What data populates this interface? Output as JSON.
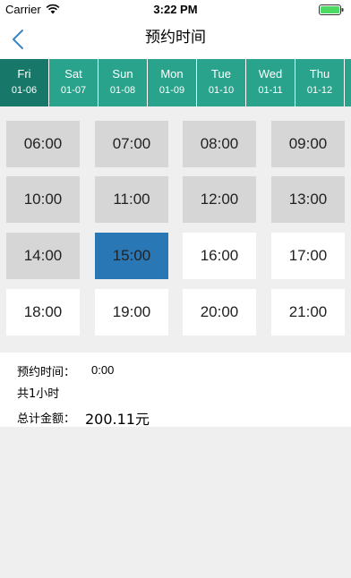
{
  "status_bar": {
    "carrier": "Carrier",
    "time": "3:22 PM"
  },
  "nav": {
    "title": "预约时间"
  },
  "days": [
    {
      "name": "Fri",
      "date": "01-06",
      "active": true
    },
    {
      "name": "Sat",
      "date": "01-07",
      "active": false
    },
    {
      "name": "Sun",
      "date": "01-08",
      "active": false
    },
    {
      "name": "Mon",
      "date": "01-09",
      "active": false
    },
    {
      "name": "Tue",
      "date": "01-10",
      "active": false
    },
    {
      "name": "Wed",
      "date": "01-11",
      "active": false
    },
    {
      "name": "Thu",
      "date": "01-12",
      "active": false
    }
  ],
  "slots": [
    {
      "time": "06:00",
      "state": "unavailable"
    },
    {
      "time": "07:00",
      "state": "unavailable"
    },
    {
      "time": "08:00",
      "state": "unavailable"
    },
    {
      "time": "09:00",
      "state": "unavailable"
    },
    {
      "time": "10:00",
      "state": "unavailable"
    },
    {
      "time": "11:00",
      "state": "unavailable"
    },
    {
      "time": "12:00",
      "state": "unavailable"
    },
    {
      "time": "13:00",
      "state": "unavailable"
    },
    {
      "time": "14:00",
      "state": "unavailable"
    },
    {
      "time": "15:00",
      "state": "selected"
    },
    {
      "time": "16:00",
      "state": "available"
    },
    {
      "time": "17:00",
      "state": "available"
    },
    {
      "time": "18:00",
      "state": "available"
    },
    {
      "time": "19:00",
      "state": "available"
    },
    {
      "time": "20:00",
      "state": "available"
    },
    {
      "time": "21:00",
      "state": "available"
    }
  ],
  "summary": {
    "time_label": "预约时间：",
    "time_value": "0:00",
    "duration": "共1小时",
    "total_label": "总计金额：",
    "total_value": "200.11元"
  },
  "colors": {
    "tab_bg": "#2aa38c",
    "tab_active": "#17786a",
    "selected_slot": "#2a77b5",
    "unavailable_slot": "#d6d6d6",
    "back_arrow": "#3a87c8"
  }
}
